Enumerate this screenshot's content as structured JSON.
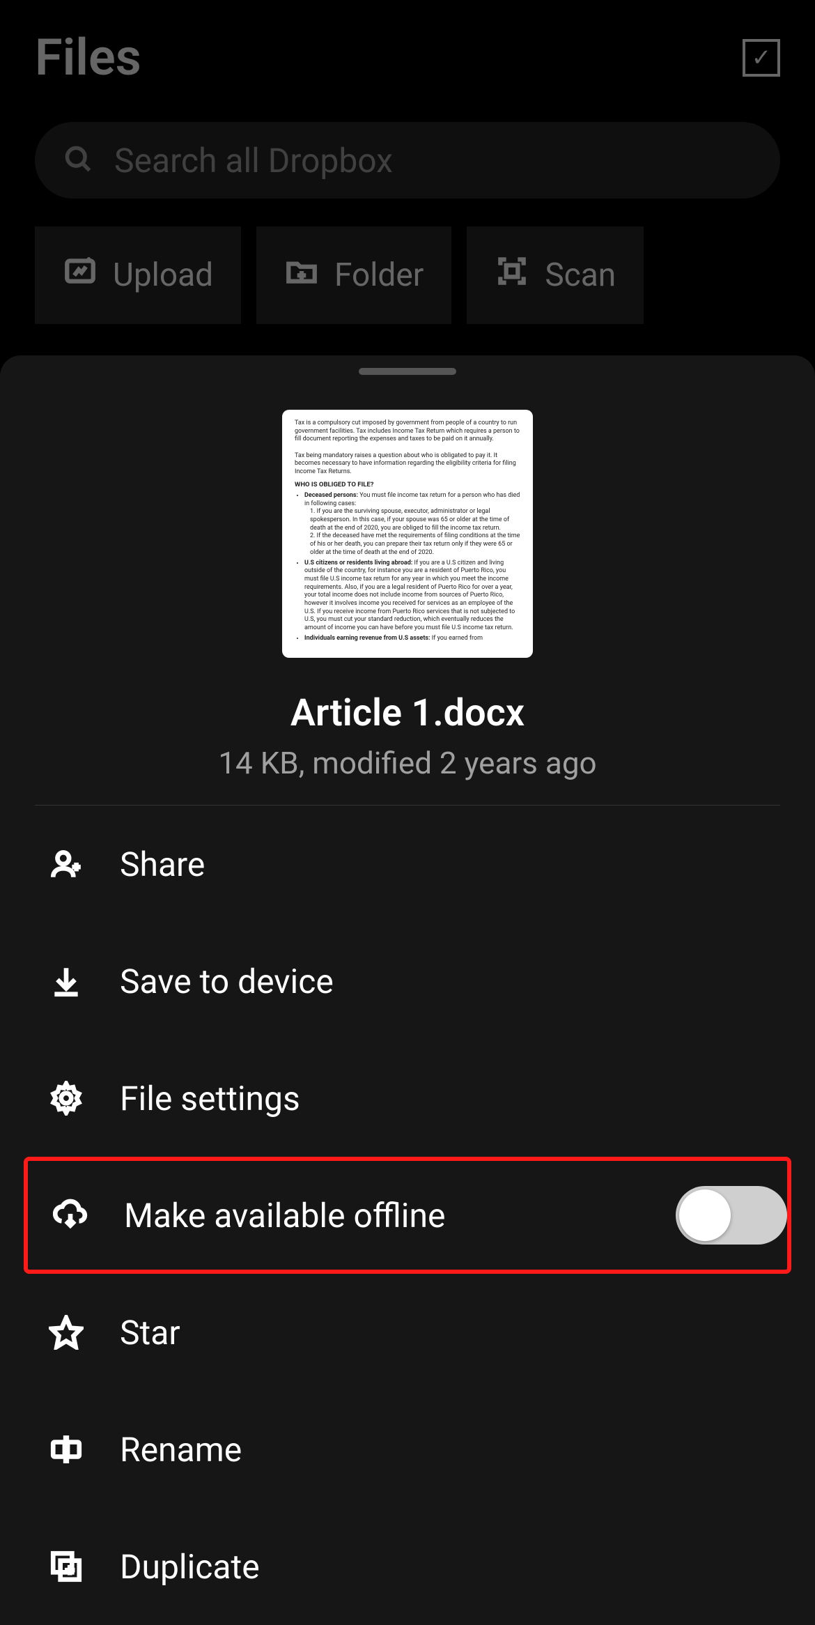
{
  "header": {
    "title": "Files"
  },
  "search": {
    "placeholder": "Search all Dropbox"
  },
  "actions": {
    "upload": "Upload",
    "folder": "Folder",
    "scan": "Scan"
  },
  "file": {
    "name": "Article 1.docx",
    "meta": "14 KB, modified 2 years ago"
  },
  "menu": {
    "share": "Share",
    "save": "Save to device",
    "settings": "File settings",
    "offline": "Make available offline",
    "offline_toggle": false,
    "star": "Star",
    "rename": "Rename",
    "duplicate": "Duplicate"
  },
  "highlight": "offline"
}
